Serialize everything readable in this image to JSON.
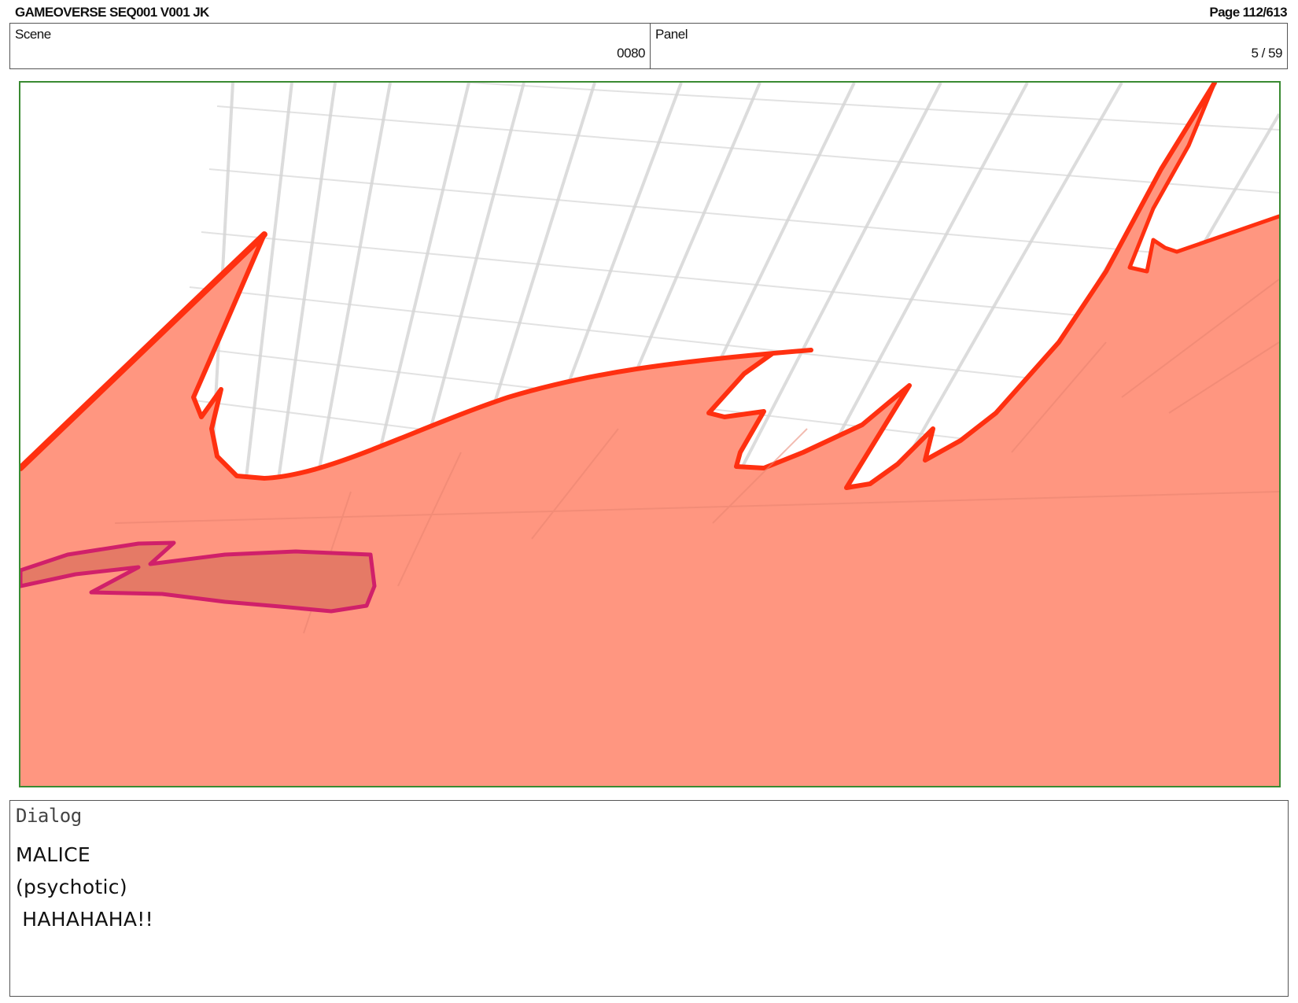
{
  "document": {
    "title": "GAMEOVERSE SEQ001 V001 JK",
    "page": "Page 112/613"
  },
  "info": {
    "scene_label": "Scene",
    "scene_value": "0080",
    "panel_label": "Panel",
    "panel_value": "5 / 59"
  },
  "dialog": {
    "label": "Dialog",
    "lines": [
      "MALICE",
      "(psychotic)",
      " HAHAHAHA!!"
    ]
  },
  "colors": {
    "frame_border": "#3a8a32",
    "flame_fill": "#ff9680",
    "flame_stroke": "#ff3010",
    "streak_fill": "#e57a66",
    "streak_stroke": "#d0206a",
    "grid_line": "#d6d6d6"
  }
}
